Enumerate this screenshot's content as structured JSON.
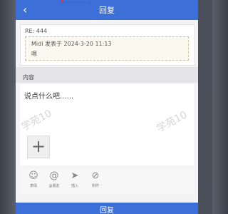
{
  "header": {
    "back_icon": "chevron-left-icon",
    "title": "回复"
  },
  "reply": {
    "re_label": "RE: 444",
    "quote_line": "Midi 发表于 2024-3-20 11:13",
    "quote_body": "嗯"
  },
  "content": {
    "label": "内容",
    "placeholder": "说点什么吧......",
    "watermark": "学苑10"
  },
  "toolbar": {
    "items": [
      {
        "icon": "emoji-icon",
        "glyph": "☺",
        "label": "表情"
      },
      {
        "icon": "mention-icon",
        "glyph": "@",
        "label": "@朋友"
      },
      {
        "icon": "send-icon",
        "glyph": "➤",
        "label": "插入"
      },
      {
        "icon": "attachment-icon",
        "glyph": "⊘",
        "label": "附件"
      }
    ]
  },
  "submit": {
    "label": "回复"
  },
  "colors": {
    "primary": "#3d6fd8",
    "background": "#f4f4f6"
  }
}
